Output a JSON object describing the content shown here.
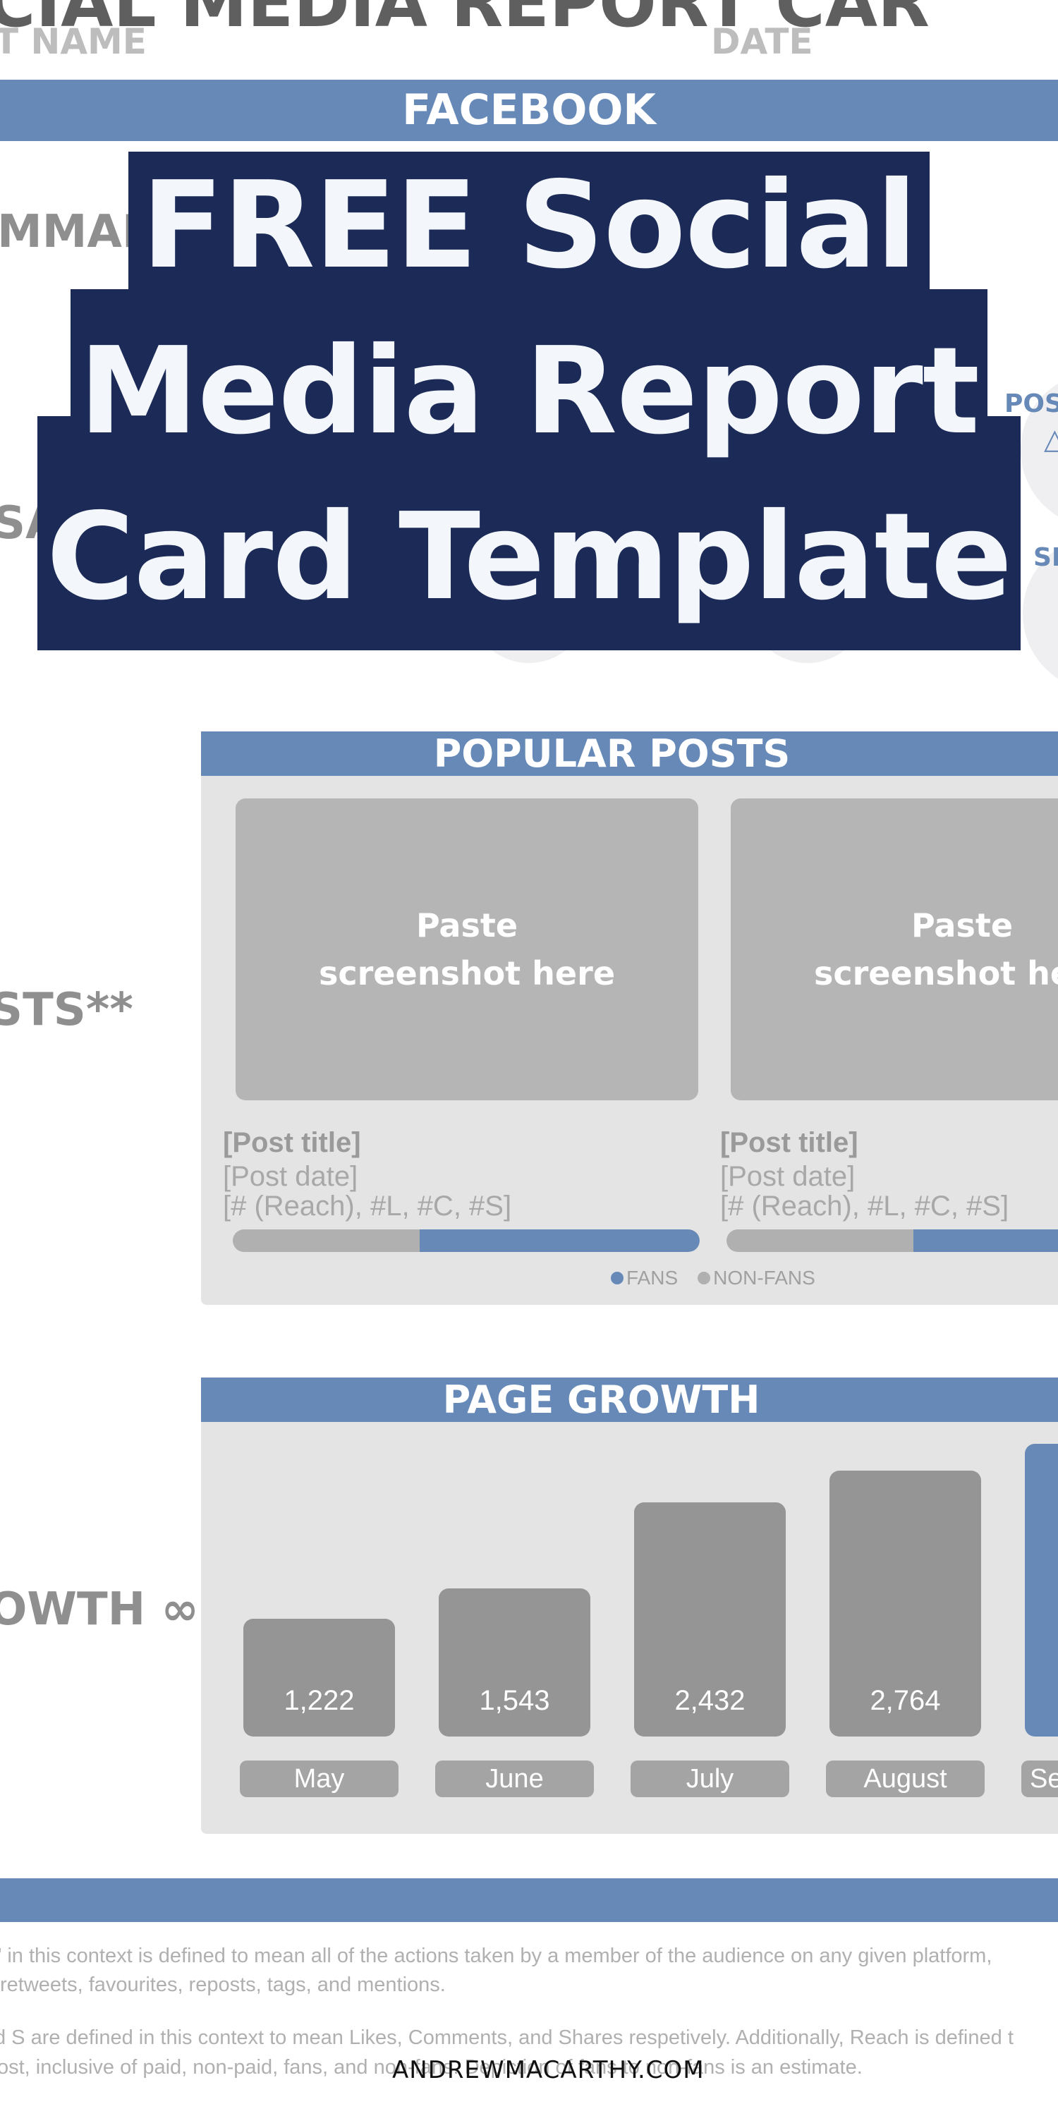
{
  "header": {
    "top_title_fragment": "CIAL MEDIA REPORT CAR",
    "client_name_label": "T NAME",
    "date_label": "DATE"
  },
  "platform_bar": {
    "label": "FACEBOOK"
  },
  "overlay_title": {
    "lines": [
      "FREE Social",
      "Media Report",
      "Card Template"
    ]
  },
  "side_labels": {
    "summary": "MMARY",
    "engagement_fragment": "SA",
    "posts": "STS**",
    "growth": "OWTH ∞"
  },
  "stat_circles": [
    {
      "label": "POS",
      "value": "△"
    },
    {
      "label": "SH",
      "value": ""
    }
  ],
  "popular_posts": {
    "title": "POPULAR POSTS",
    "posts": [
      {
        "placeholder_line1": "Paste",
        "placeholder_line2": "screenshot here",
        "title": "[Post title]",
        "date": "[Post date]",
        "stats": "[# (Reach), #L, #C, #S]",
        "fan_share": 0.6
      },
      {
        "placeholder_line1": "Paste",
        "placeholder_line2": "screenshot here",
        "title": "[Post title]",
        "date": "[Post date]",
        "stats": "[# (Reach), #L, #C, #S]",
        "fan_share": 0.6
      }
    ],
    "legend": [
      {
        "label": "FANS",
        "color": "#6689b8"
      },
      {
        "label": "NON-FANS",
        "color": "#b0b0b0"
      }
    ]
  },
  "page_growth": {
    "title": "PAGE GROWTH"
  },
  "chart_data": {
    "type": "bar",
    "title": "PAGE GROWTH",
    "categories": [
      "May",
      "June",
      "July",
      "August",
      "Se"
    ],
    "values": [
      1222,
      1543,
      2432,
      2764,
      null
    ],
    "value_labels": [
      "1,222",
      "1,543",
      "2,432",
      "2,764",
      ""
    ],
    "highlight_index": 4,
    "colors": {
      "default": "#959595",
      "highlight": "#6689b8"
    },
    "xlabel": "",
    "ylabel": ""
  },
  "footnotes": [
    "\" in this context is defined to mean all of the actions taken by a member of the audience on any given platform,",
    "retweets, favourites, reposts, tags, and mentions.",
    "d S are defined in this context to mean Likes, Comments, and Shares respetively. Additionally, Reach is defined t",
    "ost, inclusive of paid, non-paid, fans, and non-fans. Depiction of fans to non-fans is an estimate."
  ],
  "watermark": "ANDREWMACARTHY.COM",
  "colors": {
    "accent_blue": "#6689b8",
    "navy": "#1b2a57",
    "panel_gray": "#e4e4e4"
  }
}
